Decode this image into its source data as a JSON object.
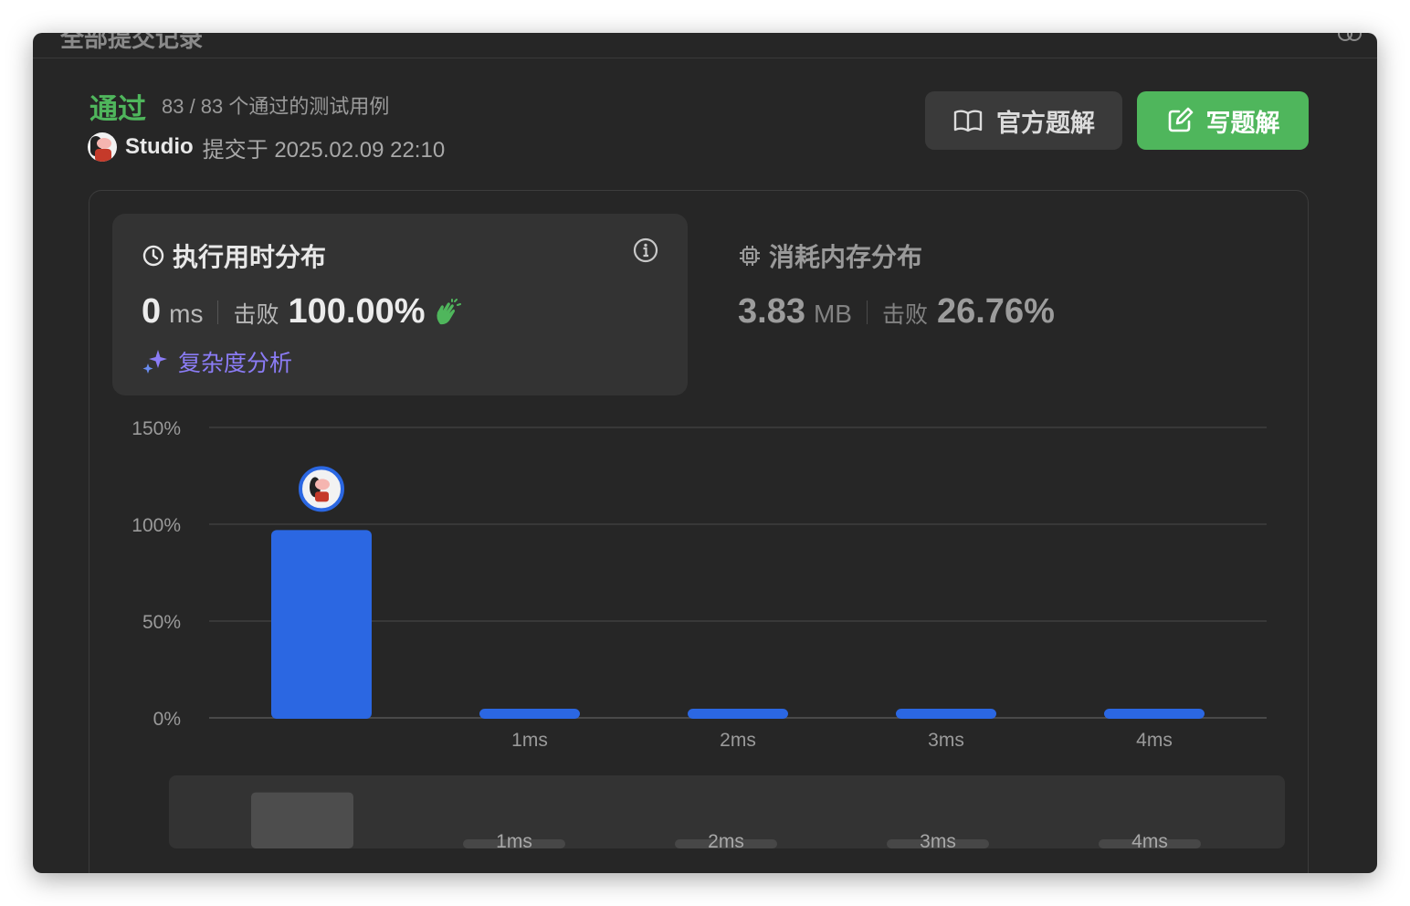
{
  "window": {
    "title": "全部提交记录"
  },
  "result": {
    "status": "通过",
    "cases": "83 / 83 个通过的测试用例",
    "user": "Studio",
    "submitted_at": "提交于 2025.02.09 22:10"
  },
  "buttons": {
    "official": "官方题解",
    "write": "写题解"
  },
  "runtime": {
    "heading": "执行用时分布",
    "value": "0",
    "unit": "ms",
    "beat_label": "击败",
    "beat_pct": "100.00%",
    "complexity_label": "复杂度分析"
  },
  "memory": {
    "heading": "消耗内存分布",
    "value": "3.83",
    "unit": "MB",
    "beat_label": "击败",
    "beat_pct": "26.76%"
  },
  "colors": {
    "accept": "#4fb65c",
    "bar": "#2b67e2",
    "ai": "#8b7cf6"
  },
  "chart_data": {
    "type": "bar",
    "categories": [
      "",
      "1ms",
      "2ms",
      "3ms",
      "4ms"
    ],
    "values": [
      97,
      2,
      2,
      2,
      2
    ],
    "y_ticks": [
      "150%",
      "100%",
      "50%",
      "0%"
    ],
    "ylim": [
      0,
      150
    ],
    "grid": true,
    "highlight_index": 0,
    "overview": {
      "categories": [
        "",
        "1ms",
        "2ms",
        "3ms",
        "4ms"
      ],
      "values": [
        97,
        2,
        2,
        2,
        2
      ]
    }
  }
}
